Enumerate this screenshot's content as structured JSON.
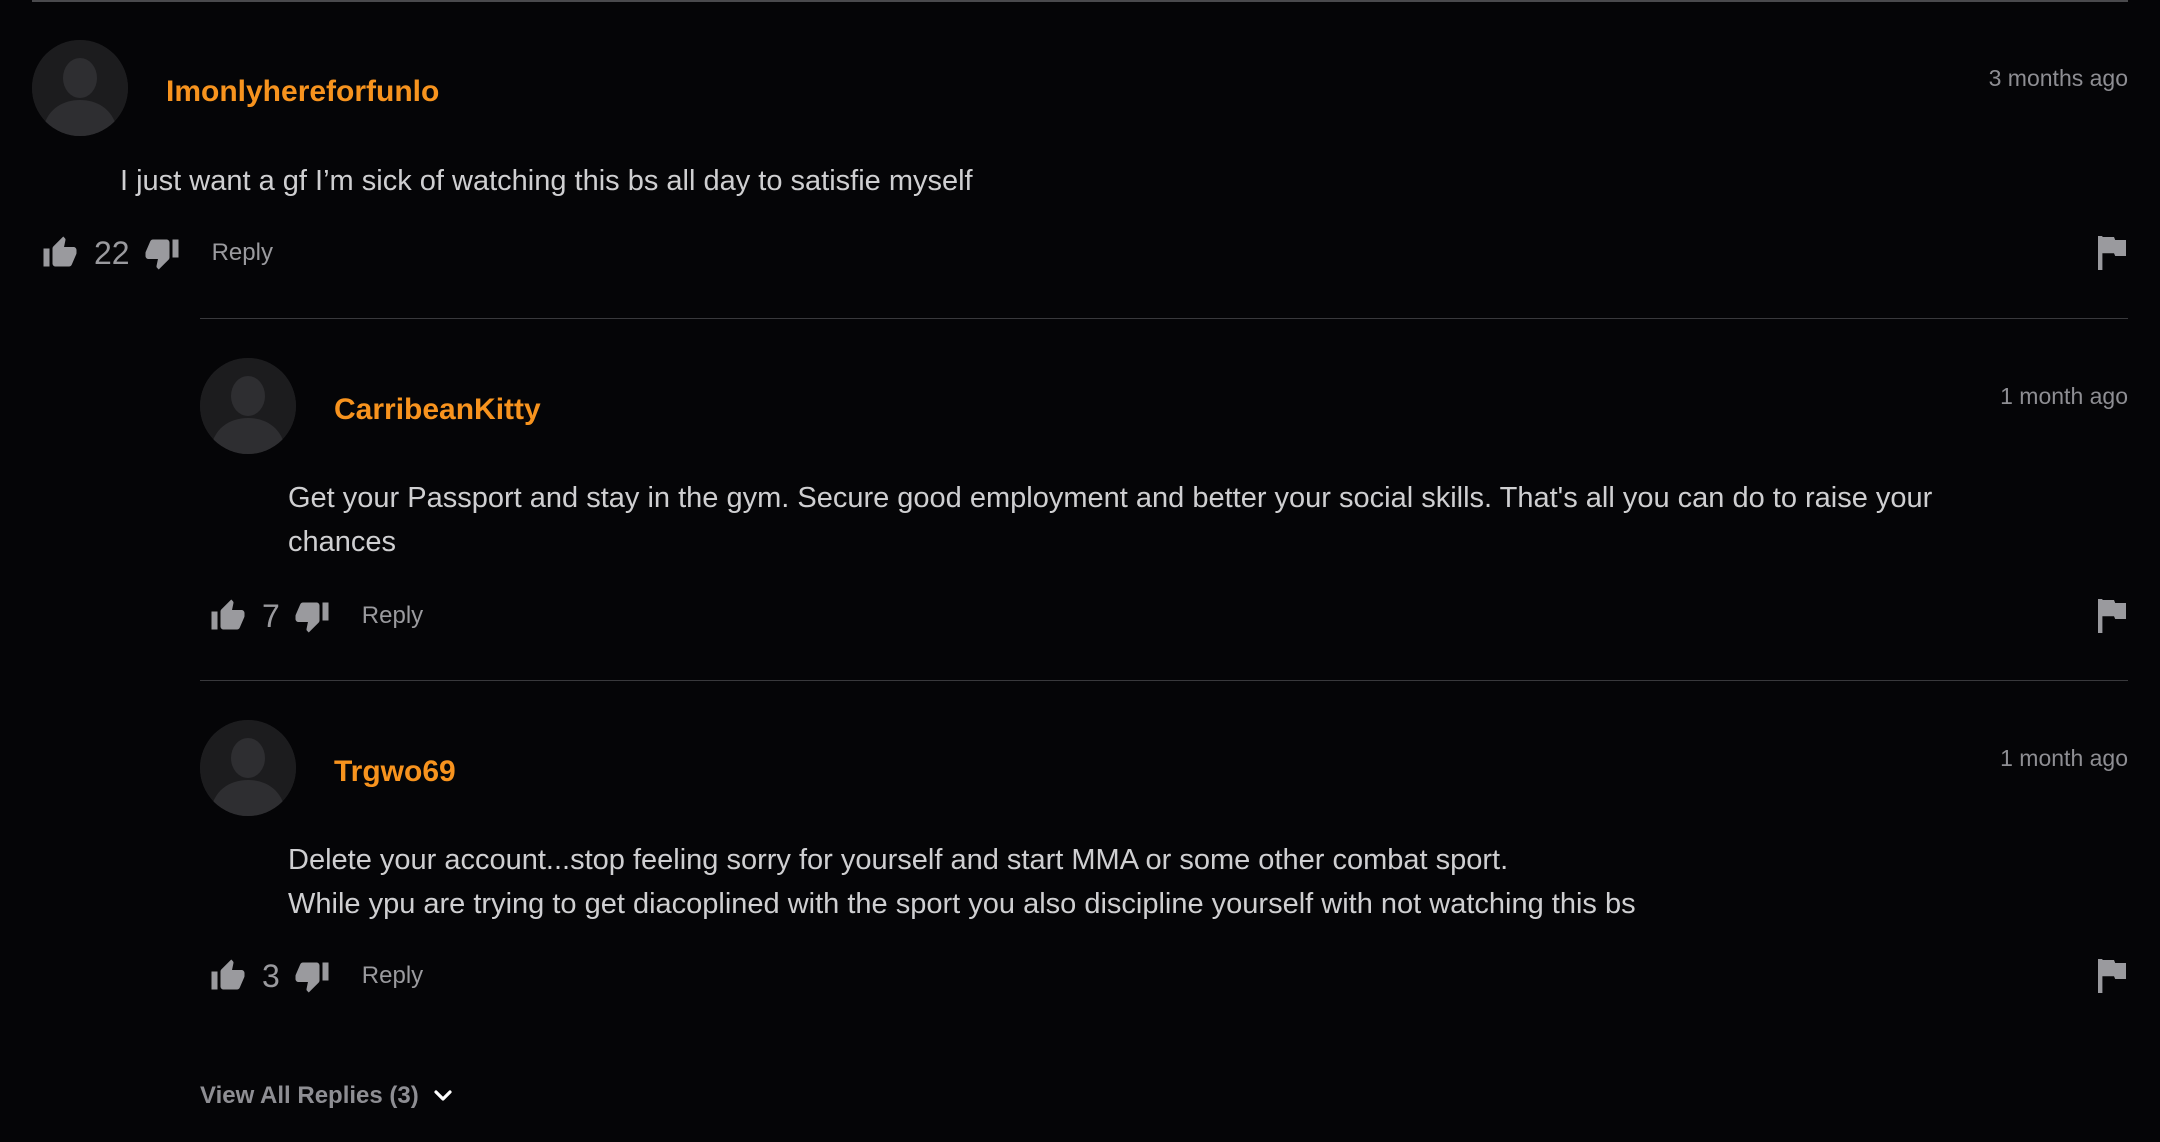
{
  "comments": [
    {
      "username": "Imonlyhereforfunlo",
      "time": "3 months ago",
      "text_lines": [
        "I just want a gf I’m sick of watching this bs all day to satisfie myself"
      ],
      "likes": "22",
      "reply_label": "Reply"
    }
  ],
  "replies": [
    {
      "username": "CarribeanKitty",
      "time": "1 month ago",
      "text_lines": [
        "Get your Passport and stay in the gym. Secure good employment and better your social skills. That's all you can do to raise your",
        "chances"
      ],
      "likes": "7",
      "reply_label": "Reply"
    },
    {
      "username": "Trgwo69",
      "time": "1 month ago",
      "text_lines": [
        "Delete your account...stop feeling sorry for yourself and start MMA or some other combat sport.",
        "While ypu are trying to get diacoplined with the sport you also discipline yourself with not watching this bs"
      ],
      "likes": "3",
      "reply_label": "Reply"
    }
  ],
  "view_all_label": "View All Replies (3)",
  "colors": {
    "background": "#050507",
    "username": "#f7931e",
    "body_text": "#cfcfd1",
    "muted": "#9a9a9e"
  },
  "icons": [
    "avatar-icon",
    "thumbs-up-icon",
    "thumbs-down-icon",
    "flag-icon",
    "chevron-down-icon"
  ]
}
